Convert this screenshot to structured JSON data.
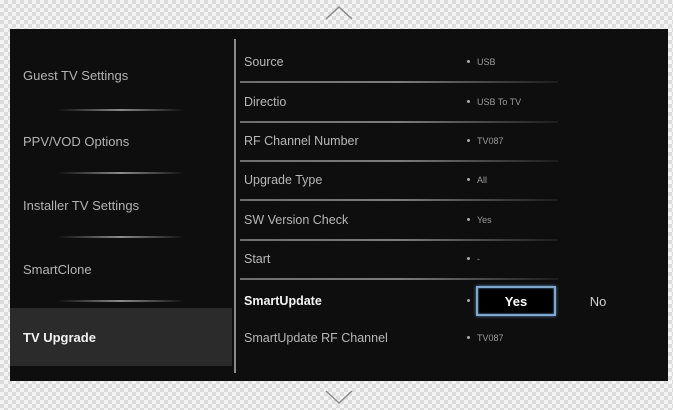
{
  "icons": {
    "scroll_up": "chevron-up-icon",
    "scroll_down": "chevron-down-icon"
  },
  "colors": {
    "panel_bg": "#0e0e0e",
    "selected_bg": "#2b2b2b",
    "focus_border": "#7fa8cf"
  },
  "left_menu": {
    "items": [
      {
        "label": "Guest TV Settings"
      },
      {
        "label": "PPV/VOD Options"
      },
      {
        "label": "Installer TV Settings"
      },
      {
        "label": "SmartClone"
      },
      {
        "label": "TV Upgrade"
      }
    ],
    "selected": "TV Upgrade"
  },
  "options": [
    {
      "label": "Source",
      "value": "USB"
    },
    {
      "label": "Directio",
      "value": "USB To TV"
    },
    {
      "label": "RF Channel Number",
      "value": "TV087"
    },
    {
      "label": "Upgrade Type",
      "value": "All"
    },
    {
      "label": "SW Version Check",
      "value": "Yes"
    },
    {
      "label": "Start",
      "value": "-"
    },
    {
      "label": "SmartUpdate",
      "choices": [
        "Yes",
        "No"
      ],
      "highlighted": "Yes"
    },
    {
      "label": "SmartUpdate RF Channel",
      "value": "TV087"
    }
  ]
}
